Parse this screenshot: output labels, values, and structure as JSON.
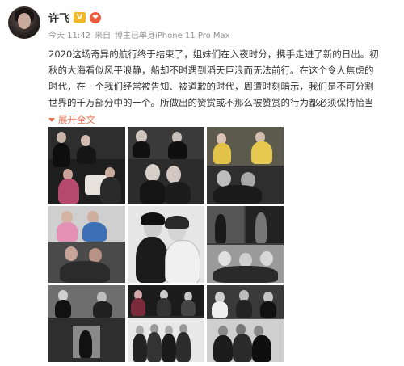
{
  "post": {
    "username": "许飞",
    "vip_badge": "V",
    "level_badge": "❤",
    "time": "今天 11:42",
    "source_prefix": "来自",
    "source": "博主已单身iPhone 11 Pro Max",
    "content_lines": [
      "2020这场奇异的航行终于结束了，姐妹们在入夜时分，携手走进了新的日出。初",
      "秋的大海看似风平浪静，船却不时遇到滔天巨浪而无法前行。在这个令人焦虑的",
      "时代，在一个我们经常被告知、被道歉的时代，周遭时刻暗示，我们是不可分割",
      "世界的千万部分中的一个。所做出的赞赏或不那么被赞赏的行为都必须保持恰当"
    ],
    "expand_label": "展开全文"
  },
  "photos": [
    {
      "name": "photo-1-group-dark",
      "tone": "#2a2a2a"
    },
    {
      "name": "photo-2-two-women",
      "tone": "#3d3d3d"
    },
    {
      "name": "photo-3-yellow-outfits",
      "tone": "#4a4a42"
    },
    {
      "name": "photo-4-pink-jackets",
      "tone": "#5a4a55"
    },
    {
      "name": "photo-5-bw-portrait",
      "tone": "#dcdcdc"
    },
    {
      "name": "photo-6-bw-collage",
      "tone": "#6a6a6a"
    },
    {
      "name": "photo-7-bw-room",
      "tone": "#555555"
    },
    {
      "name": "photo-8-group-dance",
      "tone": "#3a3a3a"
    },
    {
      "name": "photo-9-group-bw",
      "tone": "#777777"
    }
  ]
}
